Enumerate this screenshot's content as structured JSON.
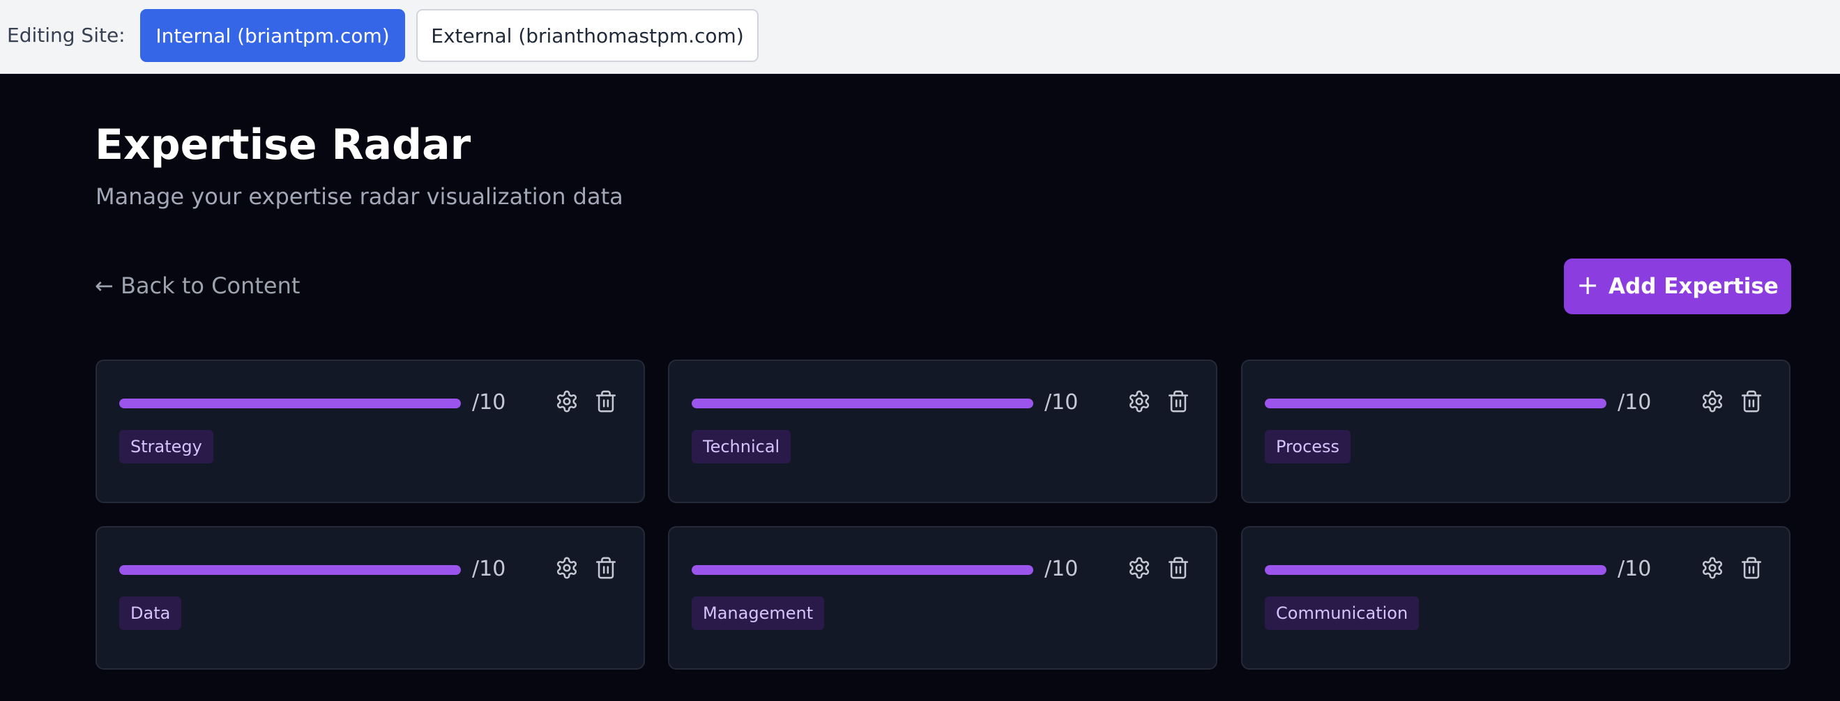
{
  "site_switcher": {
    "label": "Editing Site:",
    "internal_label": "Internal (briantpm.com)",
    "external_label": "External (brianthomastpm.com)",
    "active": "internal"
  },
  "header": {
    "title": "Expertise Radar",
    "subtitle": "Manage your expertise radar visualization data"
  },
  "actions": {
    "back_label": "← Back to Content",
    "add_label": "Add Expertise",
    "add_icon": "plus-icon"
  },
  "colors": {
    "accent": "#8b3de0",
    "bar_fill": "#9b55ec",
    "active_site": "#3566e8",
    "background": "#05060f",
    "card": "#131826"
  },
  "expertise_items": [
    {
      "category": "Strategy",
      "score_suffix": "/10",
      "level": 1.0
    },
    {
      "category": "Technical",
      "score_suffix": "/10",
      "level": 1.0
    },
    {
      "category": "Process",
      "score_suffix": "/10",
      "level": 1.0
    },
    {
      "category": "Data",
      "score_suffix": "/10",
      "level": 1.0
    },
    {
      "category": "Management",
      "score_suffix": "/10",
      "level": 1.0
    },
    {
      "category": "Communication",
      "score_suffix": "/10",
      "level": 1.0
    }
  ],
  "item_icons": {
    "settings": "gear-icon",
    "delete": "trash-icon"
  }
}
